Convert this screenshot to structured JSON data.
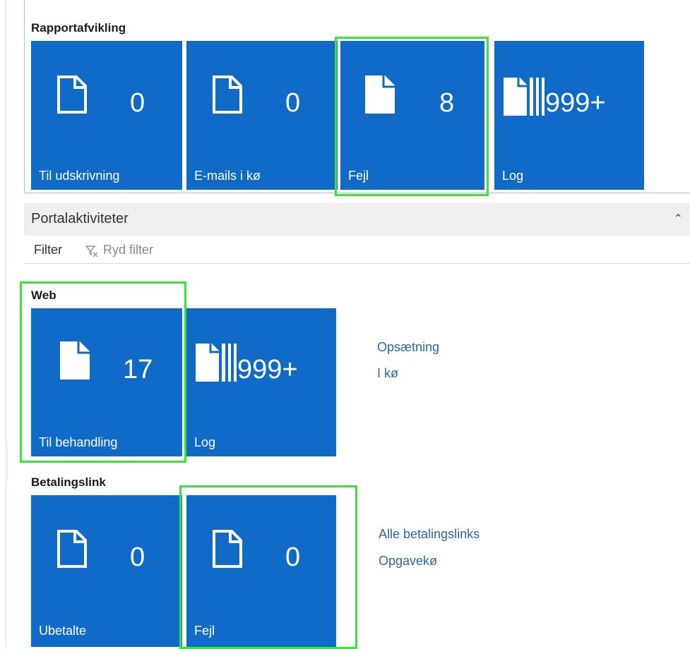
{
  "report": {
    "title": "Rapportafvikling",
    "tiles": [
      {
        "count": "0",
        "label": "Til udskrivning",
        "icon": "document-outline-icon"
      },
      {
        "count": "0",
        "label": "E-mails i kø",
        "icon": "document-outline-icon"
      },
      {
        "count": "8",
        "label": "Fejl",
        "icon": "document-filled-icon"
      },
      {
        "count": "999+",
        "label": "Log",
        "icon": "document-stack-icon"
      }
    ]
  },
  "portal": {
    "title": "Portalaktiviteter",
    "collapse_icon": "chevron-up-icon",
    "filter_label": "Filter",
    "clear_filter_label": "Ryd filter"
  },
  "web": {
    "title": "Web",
    "tiles": [
      {
        "count": "17",
        "label": "Til behandling",
        "icon": "document-filled-icon"
      },
      {
        "count": "999+",
        "label": "Log",
        "icon": "document-stack-icon"
      }
    ],
    "links": [
      "Opsætning",
      "I kø"
    ]
  },
  "payment": {
    "title": "Betalingslink",
    "tiles": [
      {
        "count": "0",
        "label": "Ubetalte",
        "icon": "document-outline-icon"
      },
      {
        "count": "0",
        "label": "Fejl",
        "icon": "document-outline-icon"
      }
    ],
    "links": [
      "Alle betalingslinks",
      "Opgavekø"
    ]
  },
  "colors": {
    "tile": "#0f6ac8",
    "highlight": "#3ee23b",
    "link": "#2a67b0"
  }
}
